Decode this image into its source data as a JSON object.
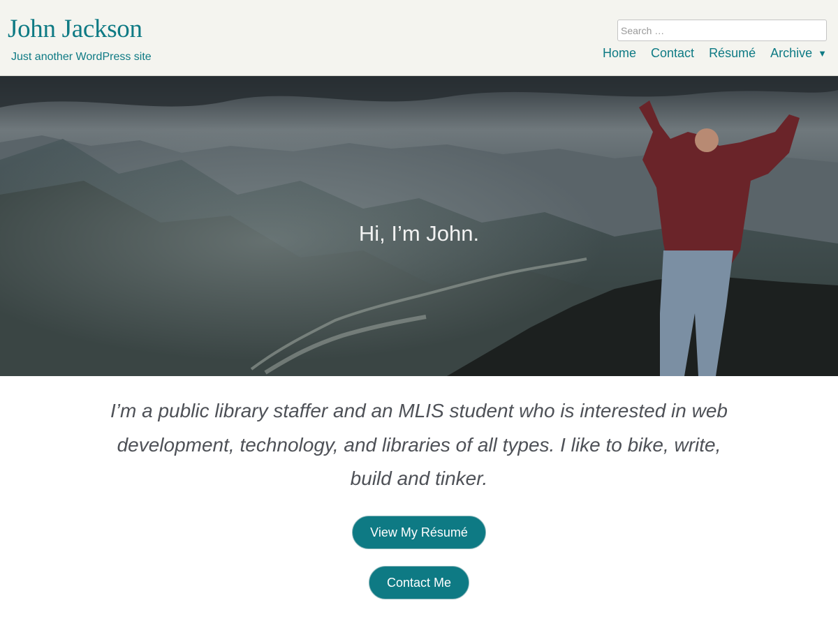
{
  "header": {
    "site_title": "John Jackson",
    "tagline": "Just another WordPress site",
    "search_placeholder": "Search …",
    "nav": [
      {
        "label": "Home"
      },
      {
        "label": "Contact"
      },
      {
        "label": "Résumé"
      },
      {
        "label": "Archive",
        "icon": "chevron-down-icon"
      }
    ]
  },
  "hero": {
    "title": "Hi, I’m John."
  },
  "main": {
    "intro": "I’m a public library staffer and an MLIS student who is interested in web development, technology, and libraries of all types. I like to bike, write, build and tinker.",
    "resume_button": "View My Résumé",
    "contact_button": "Contact Me"
  },
  "colors": {
    "accent": "#0e7a84",
    "header_bg": "#f4f4ef",
    "body_text": "#4e5157"
  }
}
